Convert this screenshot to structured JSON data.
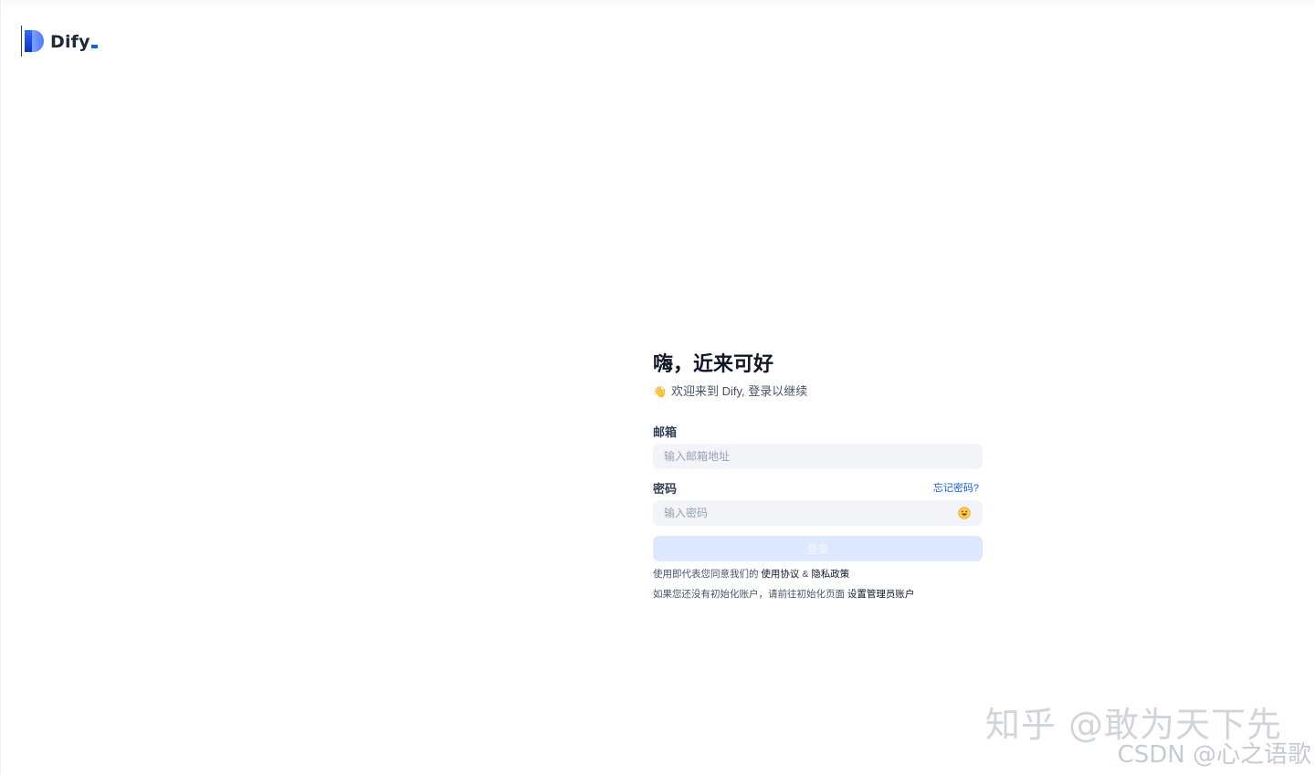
{
  "header": {
    "logo_text": "Dify"
  },
  "login": {
    "title": "嗨，近来可好",
    "subtitle_emoji": "👋",
    "subtitle": "欢迎来到 Dify, 登录以继续",
    "email": {
      "label": "邮箱",
      "placeholder": "输入邮箱地址",
      "value": ""
    },
    "password": {
      "label": "密码",
      "forgot_label": "忘记密码?",
      "placeholder": "输入密码",
      "value": "",
      "toggle_icon": "eye-toggle-icon"
    },
    "submit_label": "登录",
    "terms": {
      "prefix": "使用即代表您同意我们的",
      "terms_link": "使用协议",
      "separator": "&",
      "privacy_link": "隐私政策"
    },
    "setup": {
      "prefix": "如果您还没有初始化账户，请前往初始化页面",
      "link": "设置管理员账户"
    }
  },
  "watermarks": {
    "zhihu": "知乎 @敢为天下先",
    "csdn": "CSDN @心之语歌"
  },
  "colors": {
    "accent": "#155EEF",
    "button_disabled": "#DDE7FD",
    "input_bg": "#F2F4F7",
    "title": "#101828"
  }
}
